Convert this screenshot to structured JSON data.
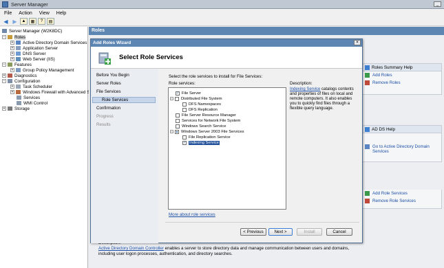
{
  "window": {
    "title": "Server Manager"
  },
  "menu": [
    "File",
    "Action",
    "View",
    "Help"
  ],
  "tree": {
    "root": "Server Manager (W2K8DC)",
    "roles": "Roles",
    "role_items": [
      "Active Directory Domain Services",
      "Application Server",
      "DNS Server",
      "Web Server (IIS)"
    ],
    "features": "Features",
    "feature_items": [
      "Group Policy Management"
    ],
    "diagnostics": "Diagnostics",
    "configuration": "Configuration",
    "config_items": [
      "Task Scheduler",
      "Windows Firewall with Advanced Sec...",
      "Services",
      "WMI Control"
    ],
    "storage": "Storage"
  },
  "content": {
    "header": "Roles",
    "panels": [
      {
        "title": "Roles Summary Help",
        "items": [
          "Add Roles",
          "Remove Roles"
        ]
      },
      {
        "title": "AD DS Help",
        "items": [
          "Go to Active Directory Domain Services"
        ]
      },
      {
        "title": "",
        "items": [
          "Add Role Services",
          "Remove Role Services"
        ]
      }
    ],
    "description_label": "Description:",
    "description_link": "Active Directory Domain Controller",
    "description_text": " enables a server to store directory data and manage communication between users and domains, including user logon processes, authentication, and directory searches."
  },
  "wizard": {
    "title": "Add Roles Wizard",
    "heading": "Select Role Services",
    "close": "×",
    "steps": [
      "Before You Begin",
      "Server Roles",
      "File Services",
      "Role Services",
      "Confirmation",
      "Progress",
      "Results"
    ],
    "instruction": "Select the role services to install for File Services:",
    "role_services_label": "Role services:",
    "services": [
      {
        "label": "File Server",
        "checked": true,
        "level": 0
      },
      {
        "label": "Distributed File System",
        "checked": false,
        "level": 0,
        "expand": true
      },
      {
        "label": "DFS Namespaces",
        "checked": false,
        "level": 1
      },
      {
        "label": "DFS Replication",
        "checked": false,
        "level": 1
      },
      {
        "label": "File Server Resource Manager",
        "checked": false,
        "level": 0
      },
      {
        "label": "Services for Network File System",
        "checked": false,
        "level": 0
      },
      {
        "label": "Windows Search Service",
        "checked": false,
        "level": 0
      },
      {
        "label": "Windows Server 2003 File Services",
        "checked": "mixed",
        "level": 0,
        "expand": true
      },
      {
        "label": "File Replication Service",
        "checked": false,
        "level": 1
      },
      {
        "label": "Indexing Service",
        "checked": true,
        "level": 1,
        "selected": true
      }
    ],
    "more_link": "More about role services",
    "description_label": "Description:",
    "description_link": "Indexing Service",
    "description_text": " catalogs contents and properties of files on local and remote computers. It also enables you to quickly find files through a flexible query language.",
    "buttons": {
      "previous": "< Previous",
      "next": "Next >",
      "install": "Install",
      "cancel": "Cancel"
    }
  }
}
